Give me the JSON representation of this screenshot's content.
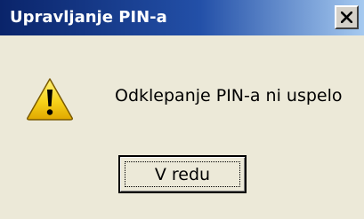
{
  "window": {
    "title": "Upravljanje PIN-a",
    "close_icon": "close-icon"
  },
  "dialog": {
    "icon": "warning-icon",
    "message": "Odklepanje PIN-a ni uspelo",
    "ok_label": "V redu"
  },
  "colors": {
    "titlebar_start": "#0a246a",
    "titlebar_end": "#a6caf0",
    "dialog_background": "#ece9d8",
    "warning_yellow": "#f7d21a"
  }
}
